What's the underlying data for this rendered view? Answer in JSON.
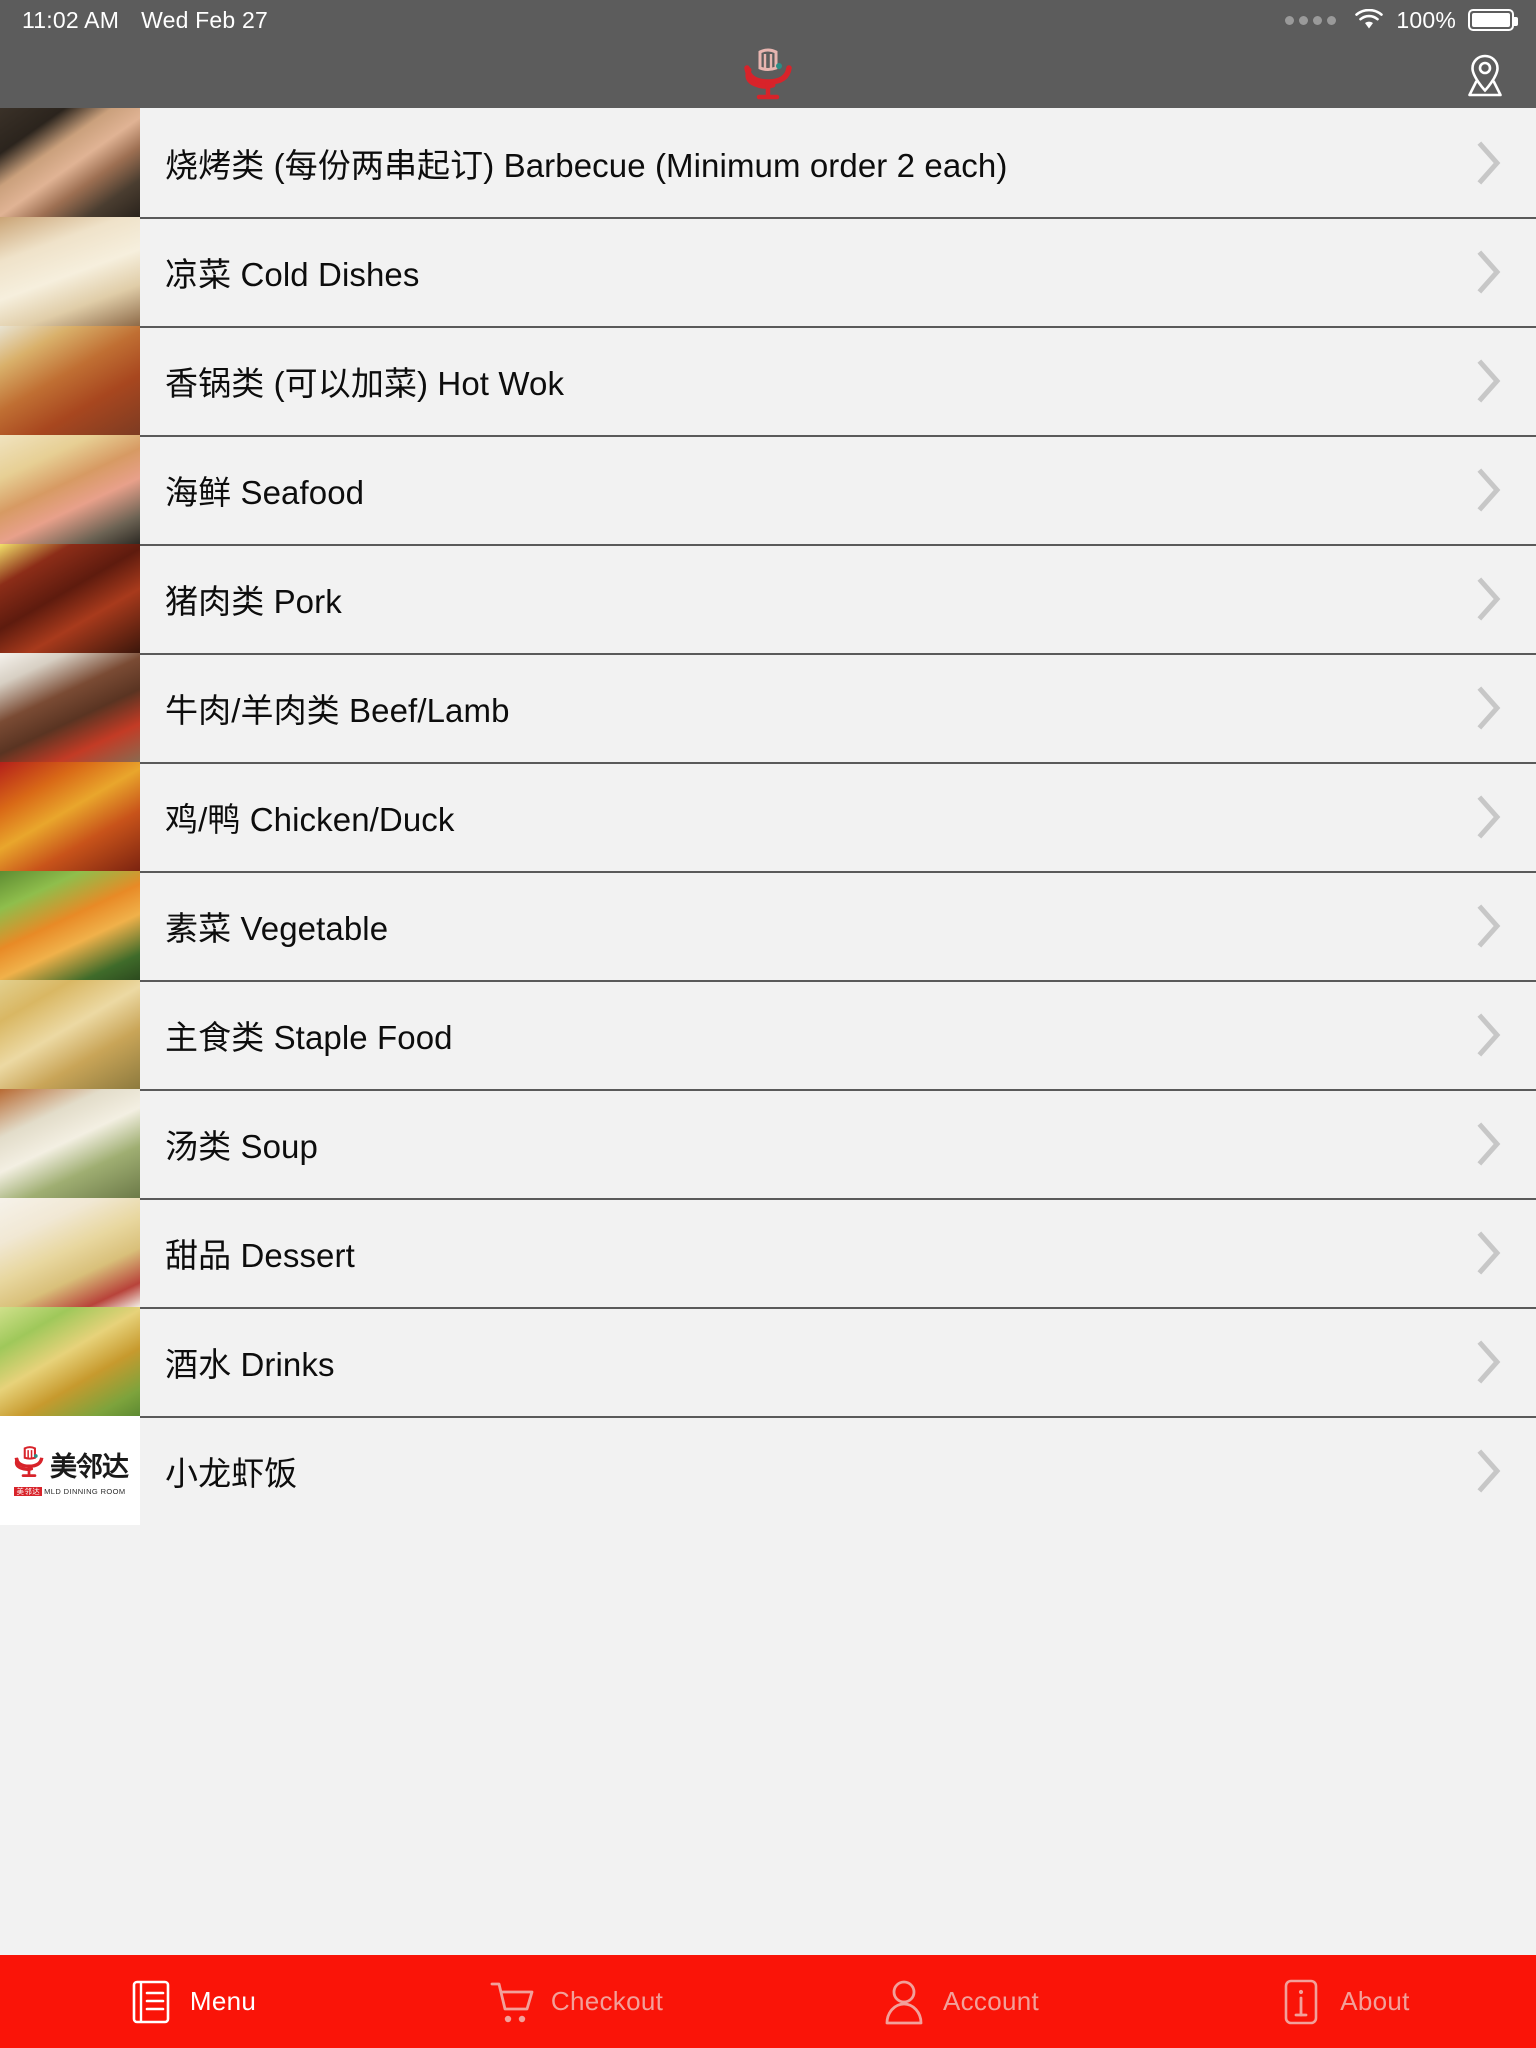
{
  "status_bar": {
    "time": "11:02 AM",
    "date": "Wed Feb 27",
    "battery_percent": "100%",
    "wifi_icon": "wifi-icon",
    "signal_icon": "signal-dots-icon",
    "battery_icon": "battery-full-icon",
    "background": "#5c5c5c"
  },
  "navbar": {
    "logo_icon": "restaurant-logo-icon",
    "location_button_icon": "map-pin-icon",
    "background": "#5c5c5c"
  },
  "menu": {
    "chevron_icon": "chevron-right-icon",
    "items": [
      {
        "label": "烧烤类 (每份两串起订) Barbecue (Minimum order 2 each)",
        "thumb": "barbecue-skewers-photo"
      },
      {
        "label": "凉菜 Cold Dishes",
        "thumb": "cold-dishes-tofu-photo"
      },
      {
        "label": "香锅类 (可以加菜) Hot Wok",
        "thumb": "hot-wok-photo"
      },
      {
        "label": "海鲜 Seafood",
        "thumb": "seafood-fried-rice-photo"
      },
      {
        "label": "猪肉类 Pork",
        "thumb": "braised-pork-photo"
      },
      {
        "label": "牛肉/羊肉类 Beef/Lamb",
        "thumb": "beef-steak-photo"
      },
      {
        "label": "鸡/鸭 Chicken/Duck",
        "thumb": "chicken-dish-photo"
      },
      {
        "label": "素菜 Vegetable",
        "thumb": "mixed-vegetables-photo"
      },
      {
        "label": "主食类 Staple Food",
        "thumb": "staple-food-photo"
      },
      {
        "label": "汤类 Soup",
        "thumb": "soup-bowl-photo"
      },
      {
        "label": "甜品 Dessert",
        "thumb": "dessert-plate-photo"
      },
      {
        "label": "酒水 Drinks",
        "thumb": "tea-drinks-photo"
      },
      {
        "label": "小龙虾饭",
        "thumb": "brand-logo-thumb"
      }
    ]
  },
  "brand": {
    "name_cn": "美邻达",
    "name_en": "MLD DINNING ROOM",
    "badge_cn": "美邻达"
  },
  "tabbar": {
    "background": "#fa1408",
    "active_color": "#ffffff",
    "inactive_color": "#f2a09a",
    "tabs": [
      {
        "label": "Menu",
        "icon": "menu-book-icon",
        "active": true
      },
      {
        "label": "Checkout",
        "icon": "shopping-cart-icon",
        "active": false
      },
      {
        "label": "Account",
        "icon": "person-icon",
        "active": false
      },
      {
        "label": "About",
        "icon": "info-icon",
        "active": false
      }
    ]
  }
}
